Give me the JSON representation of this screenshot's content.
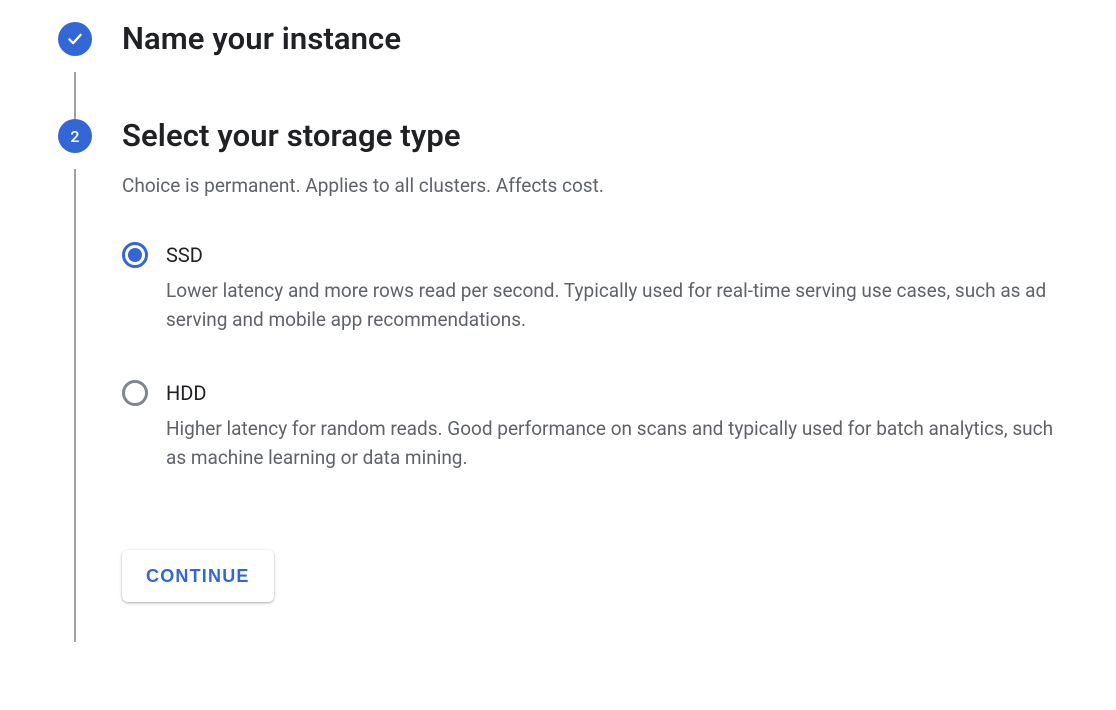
{
  "steps": {
    "name_instance": {
      "title": "Name your instance",
      "completed": true
    },
    "storage_type": {
      "number": "2",
      "title": "Select your storage type",
      "subtitle": "Choice is permanent. Applies to all clusters. Affects cost.",
      "options": {
        "ssd": {
          "label": "SSD",
          "description": "Lower latency and more rows read per second. Typically used for real-time serving use cases, such as ad serving and mobile app recommendations.",
          "selected": true
        },
        "hdd": {
          "label": "HDD",
          "description": "Higher latency for random reads. Good performance on scans and typically used for batch analytics, such as machine learning or data mining.",
          "selected": false
        }
      },
      "continue_label": "CONTINUE"
    }
  }
}
